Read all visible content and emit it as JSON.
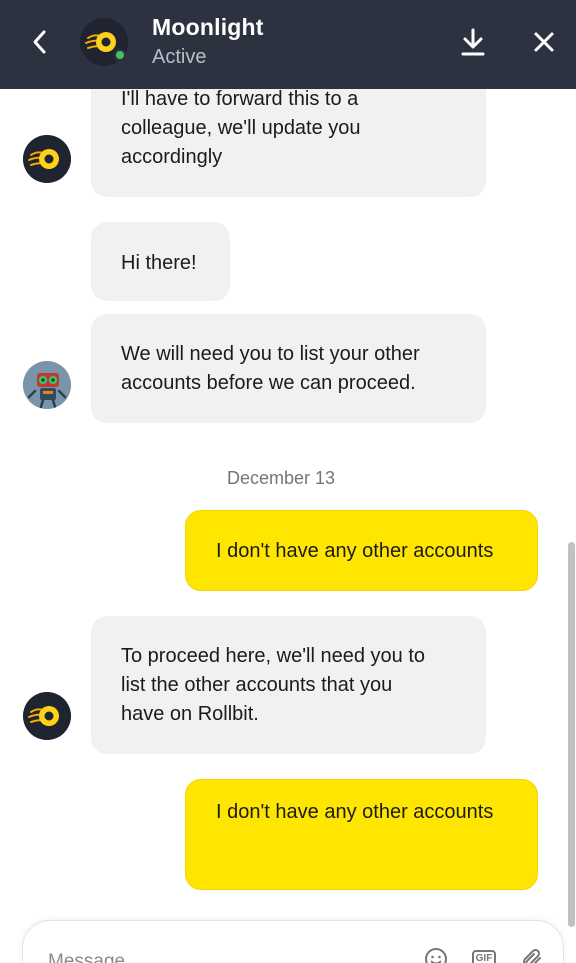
{
  "header": {
    "name": "Moonlight",
    "status": "Active",
    "colors": {
      "background": "#2c323f",
      "online": "#3fc35a"
    },
    "icons": {
      "back": "chevron-left-icon",
      "download": "download-icon",
      "close": "close-icon"
    }
  },
  "messages": [
    {
      "sender": "agent",
      "avatar": "moonlight-avatar",
      "lines": [
        "I'll have to forward this to a",
        "colleague, we'll update you",
        "accordingly"
      ]
    },
    {
      "sender": "agent",
      "lines": [
        "Hi there!"
      ]
    },
    {
      "sender": "agent",
      "avatar": "robot-avatar",
      "lines": [
        "We will need you to list your other",
        "accounts before we can proceed."
      ]
    },
    {
      "type": "date",
      "text": "December 13"
    },
    {
      "sender": "user",
      "lines": [
        "I don't have any other accounts"
      ]
    },
    {
      "sender": "agent",
      "avatar": "moonlight-avatar",
      "lines": [
        "To proceed here, we'll need you to",
        "list the other accounts that you",
        "have on Rollbit."
      ]
    },
    {
      "sender": "user",
      "lines": [
        "I don't have any other accounts"
      ]
    }
  ],
  "composer": {
    "placeholder": "Message",
    "gif_label": "GIF",
    "icons": {
      "emoji": "emoji-icon",
      "gif": "gif-icon",
      "attach": "paperclip-icon"
    }
  },
  "colors": {
    "user_bubble": "#ffe600",
    "agent_bubble": "#f1f1f2"
  }
}
